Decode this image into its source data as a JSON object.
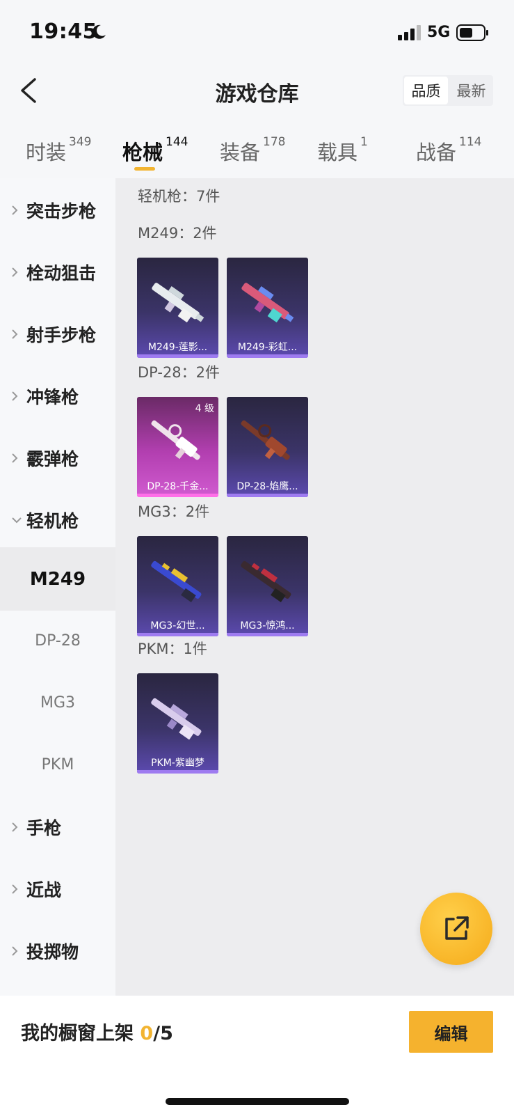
{
  "status_bar": {
    "time": "19:45",
    "network": "5G"
  },
  "nav": {
    "title": "游戏仓库",
    "sort_options": [
      "品质",
      "最新"
    ],
    "sort_active": "品质"
  },
  "tabs": [
    {
      "label": "时装",
      "count": "349"
    },
    {
      "label": "枪械",
      "count": "144",
      "active": true
    },
    {
      "label": "装备",
      "count": "178"
    },
    {
      "label": "载具",
      "count": "1"
    },
    {
      "label": "战备",
      "count": "114"
    }
  ],
  "sidebar": {
    "categories": [
      "突击步枪",
      "栓动狙击",
      "射手步枪",
      "冲锋枪",
      "霰弹枪",
      "轻机枪",
      "手枪",
      "近战",
      "投掷物"
    ],
    "expanded": "轻机枪",
    "subitems": [
      "M249",
      "DP-28",
      "MG3",
      "PKM"
    ],
    "active_sub": "M249"
  },
  "content": {
    "header": "轻机枪：7件",
    "groups": [
      {
        "label": "M249：2件",
        "items": [
          {
            "name": "M249-莲影...",
            "color": "purple"
          },
          {
            "name": "M249-彩虹...",
            "color": "purple"
          }
        ]
      },
      {
        "label": "DP-28：2件",
        "items": [
          {
            "name": "DP-28-千金...",
            "color": "pink",
            "level": "4 级"
          },
          {
            "name": "DP-28-焰鹰...",
            "color": "purple"
          }
        ]
      },
      {
        "label": "MG3：2件",
        "items": [
          {
            "name": "MG3-幻世...",
            "color": "purple"
          },
          {
            "name": "MG3-惊鸿...",
            "color": "purple"
          }
        ]
      },
      {
        "label": "PKM：1件",
        "items": [
          {
            "name": "PKM-紫幽梦",
            "color": "purple"
          }
        ]
      }
    ]
  },
  "bottom_bar": {
    "label_prefix": "我的橱窗上架 ",
    "current": "0",
    "total_suffix": "/5",
    "edit_label": "编辑"
  },
  "colors": {
    "accent": "#f2b431",
    "card_purple": "#3b3468",
    "card_pink": "#b23fb0"
  }
}
